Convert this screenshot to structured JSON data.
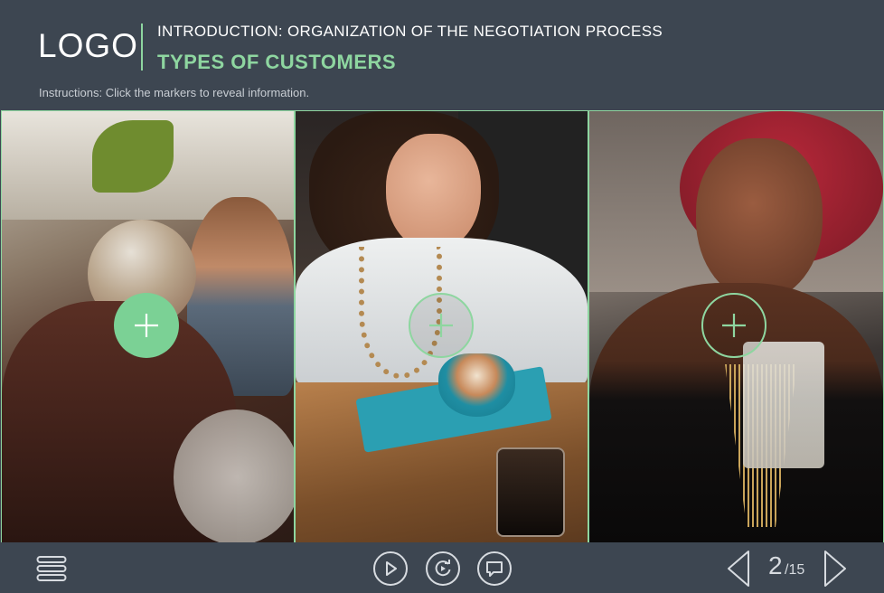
{
  "header": {
    "logo": "LOGO",
    "course_title": "INTRODUCTION: ORGANIZATION OF THE NEGOTIATION PROCESS",
    "section_title": "TYPES OF CUSTOMERS",
    "instructions": "Instructions: Click the markers to reveal information."
  },
  "colors": {
    "background": "#3d4651",
    "accent": "#8ed6a0",
    "text": "#ffffff",
    "icon": "#d7dbe0"
  },
  "panels": [
    {
      "name": "panel-older-man",
      "marker_state": "filled",
      "marker_icon": "plus-icon"
    },
    {
      "name": "panel-woman-coffee",
      "marker_state": "outline",
      "marker_icon": "plus-icon"
    },
    {
      "name": "panel-woman-drink",
      "marker_state": "outline",
      "marker_icon": "plus-icon"
    }
  ],
  "footer": {
    "menu_icon": "menu-icon",
    "play_icon": "play-icon",
    "replay_icon": "replay-icon",
    "comment_icon": "comment-icon",
    "prev_icon": "prev-arrow-icon",
    "next_icon": "next-arrow-icon",
    "page_current": "2",
    "page_total": "/15"
  }
}
